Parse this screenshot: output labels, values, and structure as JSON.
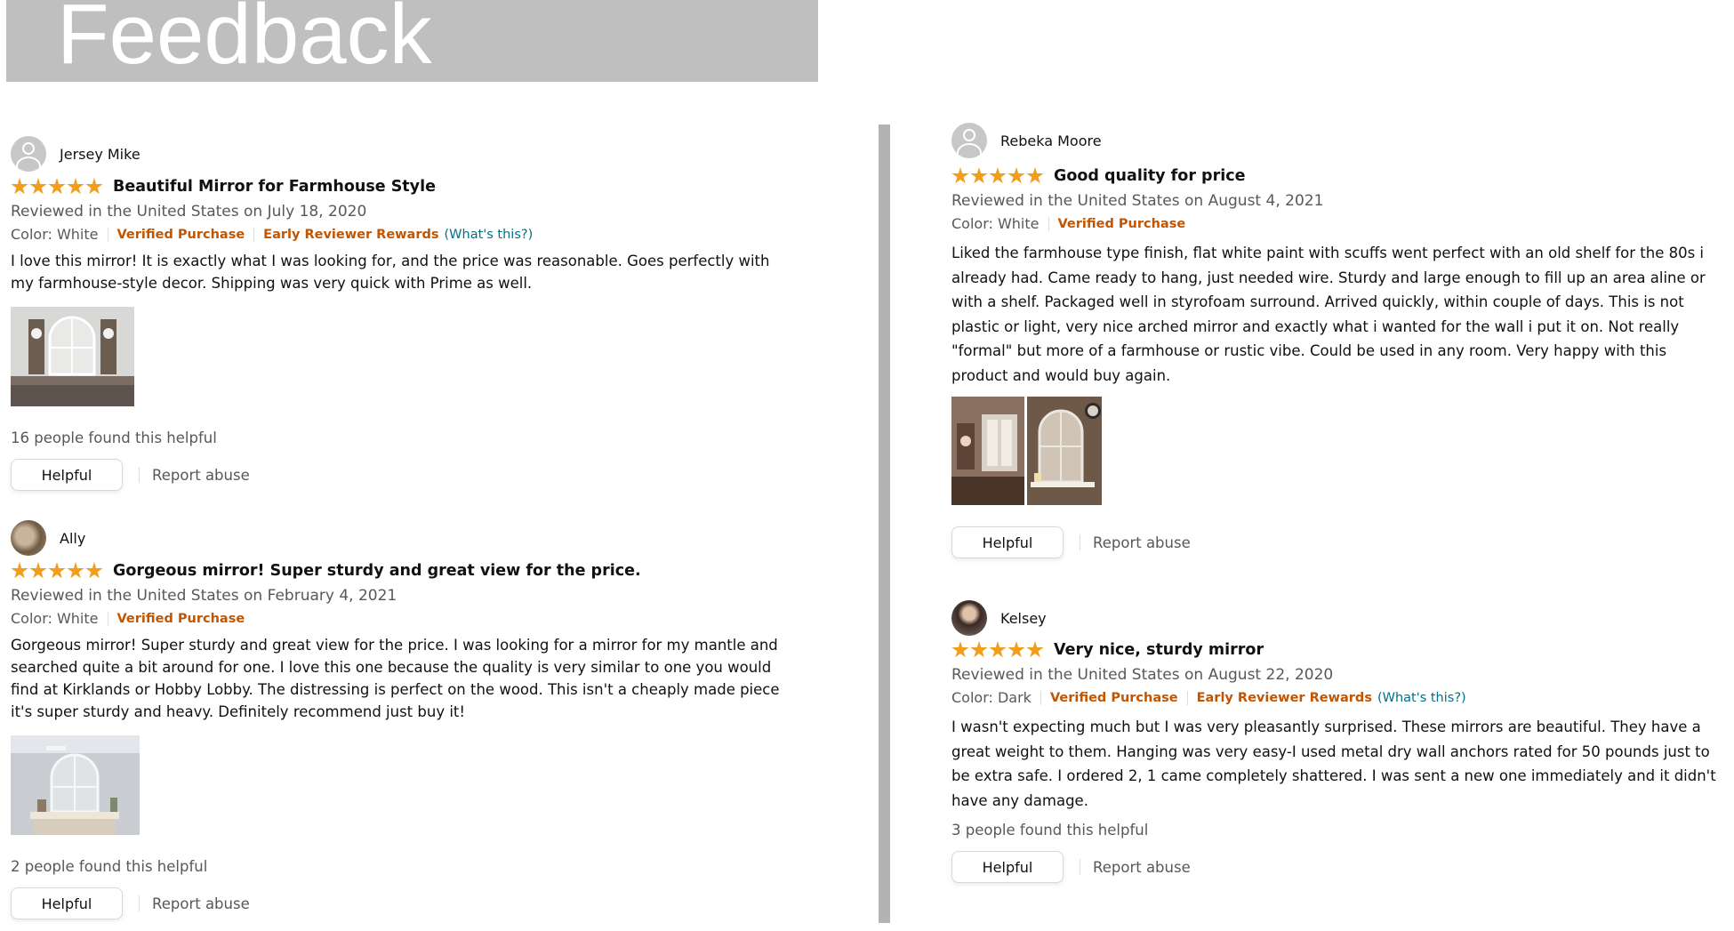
{
  "banner": {
    "title": "Feedback"
  },
  "reviews_left": [
    {
      "author": "Jersey Mike",
      "rating": 5,
      "title": "Beautiful Mirror for Farmhouse Style",
      "reviewed": "Reviewed in the United States on July 18, 2020",
      "color": "Color: White",
      "verified": "Verified Purchase",
      "early_reviewer": "Early Reviewer Rewards",
      "whats_this": "(What's this?)",
      "body": "I love this mirror! It is exactly what I was looking for, and the price was reasonable. Goes perfectly with my farmhouse-style decor. Shipping was very quick with Prime as well.",
      "helpful_count": "16 people found this helpful",
      "helpful_label": "Helpful",
      "report_label": "Report abuse"
    },
    {
      "author": "Ally",
      "rating": 5,
      "title": "Gorgeous mirror! Super sturdy and great view for the price.",
      "reviewed": "Reviewed in the United States on February 4, 2021",
      "color": "Color: White",
      "verified": "Verified Purchase",
      "body": "Gorgeous mirror! Super sturdy and great view for the price. I was looking for a mirror for my mantle and searched quite a bit around for one. I love this one because the quality is very similar to one you would find at Kirklands or Hobby Lobby. The distressing is perfect on the wood. This isn't a cheaply made piece it's super sturdy and heavy. Definitely recommend just buy it!",
      "helpful_count": "2 people found this helpful",
      "helpful_label": "Helpful",
      "report_label": "Report abuse"
    }
  ],
  "reviews_right": [
    {
      "author": "Rebeka Moore",
      "rating": 5,
      "title": "Good quality for price",
      "reviewed": "Reviewed in the United States on August 4, 2021",
      "color": "Color: White",
      "verified": "Verified Purchase",
      "body": "Liked the farmhouse type finish, flat white paint with scuffs went perfect with an old shelf for the 80s i already had. Came ready to hang, just needed wire. Sturdy and large enough to fill up an area aline or with a shelf. Packaged well in styrofoam surround. Arrived quickly, within couple of days. This is not plastic or light, very nice arched mirror and exactly what i wanted for the wall i put it on. Not really \"formal\" but more of a farmhouse or rustic vibe. Could be used in any room. Very happy with this product and would buy again.",
      "helpful_label": "Helpful",
      "report_label": "Report abuse"
    },
    {
      "author": "Kelsey",
      "rating": 5,
      "title": "Very nice, sturdy mirror",
      "reviewed": "Reviewed in the United States on August 22, 2020",
      "color": "Color: Dark",
      "verified": "Verified Purchase",
      "early_reviewer": "Early Reviewer Rewards",
      "whats_this": "(What's this?)",
      "body": "I wasn't expecting much but I was very pleasantly surprised. These mirrors are beautiful. They have a great weight to them. Hanging was very easy-I used metal dry wall anchors rated for 50 pounds just to be extra safe. I ordered 2, 1 came completely shattered. I was sent a new one immediately and it didn't have any damage.",
      "helpful_count": "3 people found this helpful",
      "helpful_label": "Helpful",
      "report_label": "Report abuse"
    }
  ],
  "colors": {
    "star": "#f19e1c",
    "verified": "#c45500",
    "link": "#007185",
    "muted": "#565959",
    "banner_bg": "#bfbfbf",
    "divider": "#b3b3b3"
  }
}
